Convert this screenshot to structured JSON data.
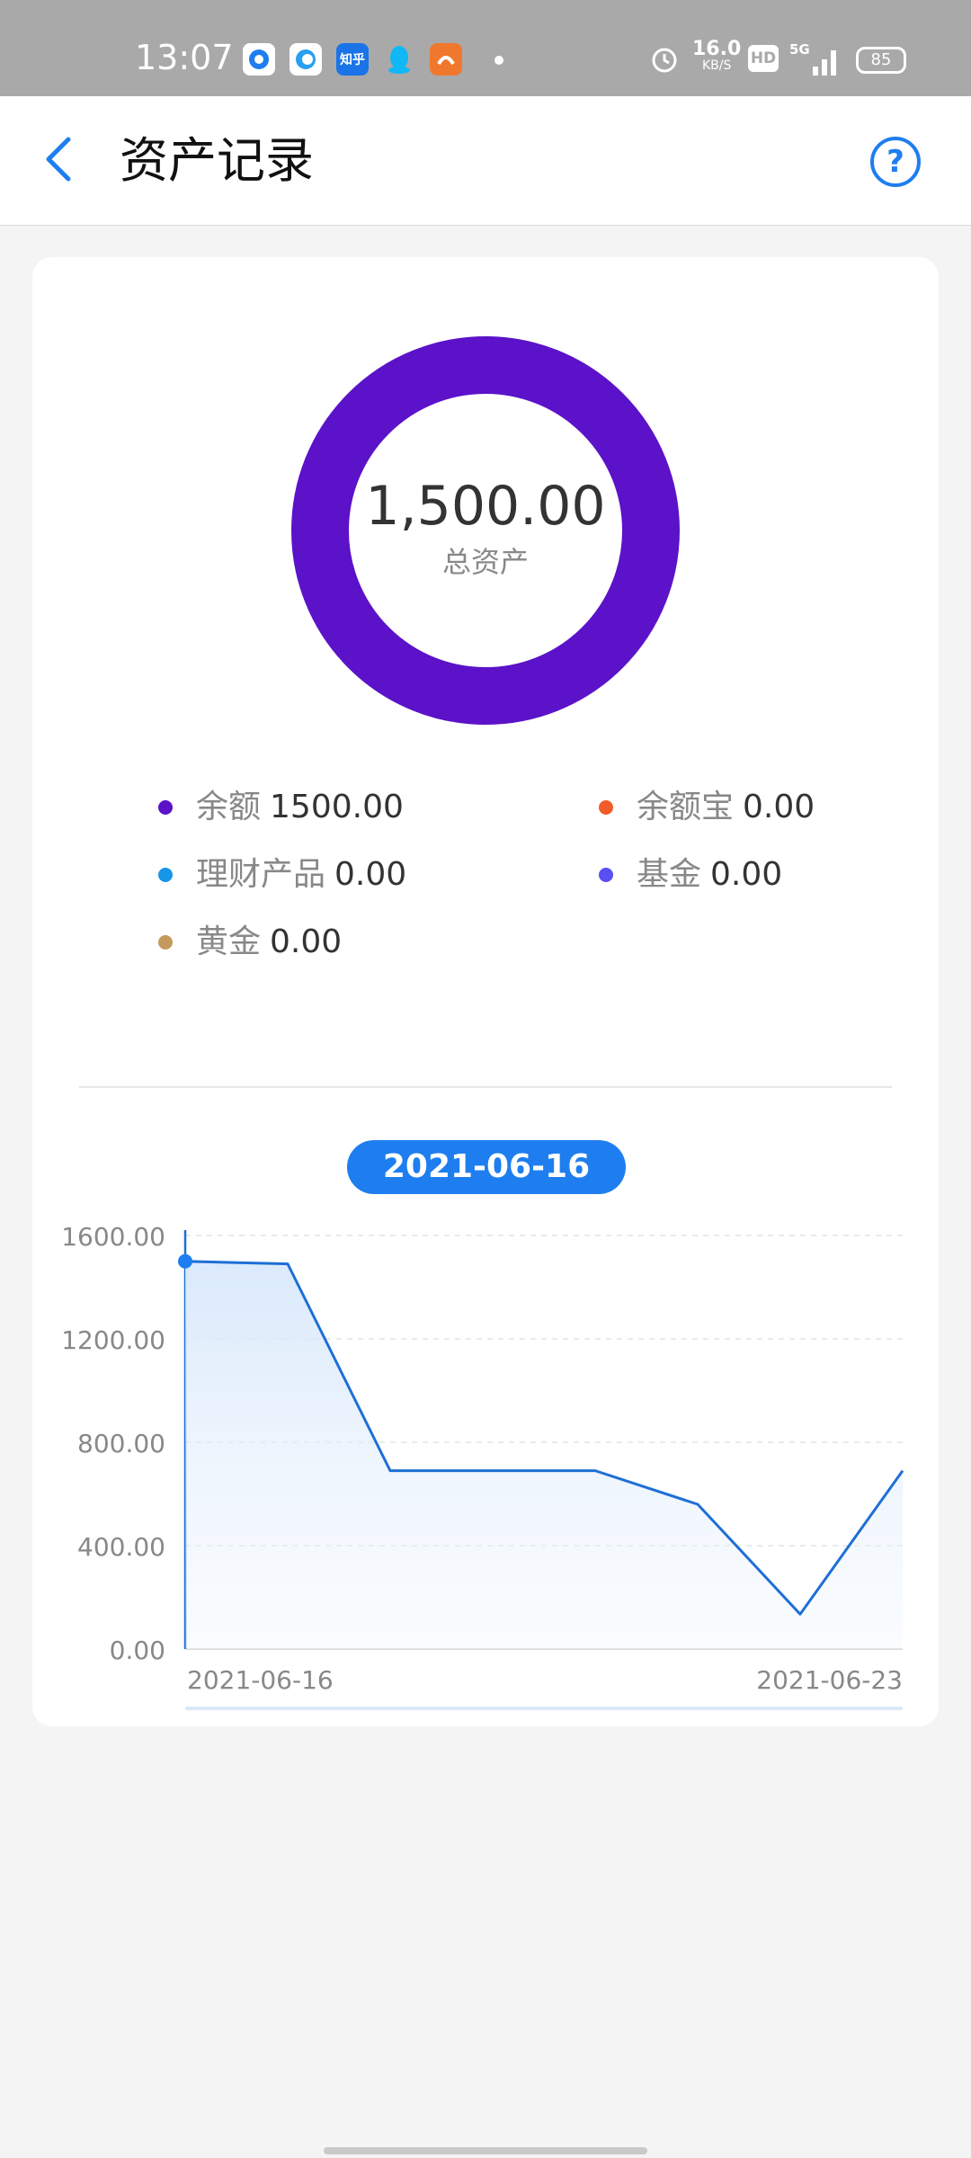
{
  "status_bar": {
    "time": "13:07",
    "net_speed": "16.0",
    "net_unit": "KB/S",
    "hd": "HD",
    "network": "5G",
    "battery": "85",
    "app_icons": [
      "browser-icon",
      "qq-browser-icon",
      "zhihu-icon",
      "qq-icon",
      "uc-browser-icon"
    ],
    "zhihu_label": "知乎"
  },
  "header": {
    "title": "资产记录",
    "help": "?"
  },
  "summary": {
    "total_value": "1,500.00",
    "total_label": "总资产",
    "ring_color": "#5b12c9"
  },
  "legend": [
    {
      "name": "余额",
      "value": "1500.00",
      "color": "#5b12c9"
    },
    {
      "name": "余额宝",
      "value": "0.00",
      "color": "#f25c2b"
    },
    {
      "name": "理财产品",
      "value": "0.00",
      "color": "#1596e8"
    },
    {
      "name": "基金",
      "value": "0.00",
      "color": "#5a4ff0"
    },
    {
      "name": "黄金",
      "value": "0.00",
      "color": "#c49a5c"
    }
  ],
  "selected_date": "2021-06-16",
  "chart_data": {
    "type": "area",
    "x": [
      "2021-06-16",
      "2021-06-17",
      "2021-06-18",
      "2021-06-19",
      "2021-06-20",
      "2021-06-21",
      "2021-06-22",
      "2021-06-23"
    ],
    "values": [
      1500,
      1490,
      690,
      690,
      690,
      560,
      135,
      690
    ],
    "x_tick_labels": [
      "2021-06-16",
      "2021-06-23"
    ],
    "y_tick_labels": [
      "0.00",
      "400.00",
      "800.00",
      "1200.00",
      "1600.00"
    ],
    "ylim": [
      0,
      1600
    ],
    "grid": true,
    "selected_index": 0,
    "line_color": "#1e6fd6"
  }
}
